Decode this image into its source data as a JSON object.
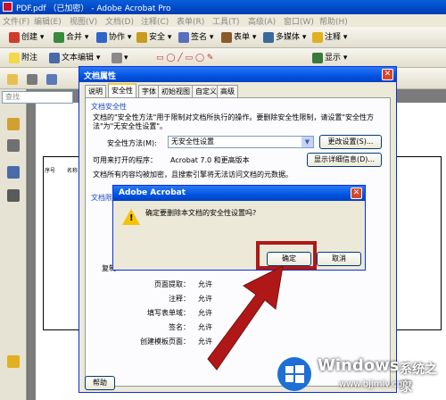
{
  "window": {
    "title": "PDF.pdf （已加密） - Adobe Acrobat Pro"
  },
  "menu": [
    "文件(F)",
    "编辑(E)",
    "视图(V)",
    "文档(D)",
    "注释(C)",
    "表单(R)",
    "工具(T)",
    "高级(A)",
    "窗口(W)",
    "帮助(H)"
  ],
  "toolbar1": {
    "create": "创建",
    "combine": "合并",
    "collaborate": "协作",
    "security": "安全",
    "sign": "签名",
    "forms": "表单",
    "multimedia": "多媒体",
    "comment": "注释"
  },
  "toolbar2": {
    "sticky_note": "附注",
    "text_edit": "文本编辑",
    "show": "显示"
  },
  "search": {
    "placeholder": "查找"
  },
  "page_table": {
    "col1": "序号",
    "col2": "名称"
  },
  "props_dialog": {
    "title": "文档属性",
    "tabs": [
      "说明",
      "安全性",
      "字体",
      "初始视图",
      "自定义",
      "高级"
    ],
    "active_tab": "安全性",
    "group1_title": "文档安全性",
    "desc": "文档的\"安全性方法\"用于限制对文档所执行的操作。要删除安全性限制，请设置\"安全性方法\"为\"无安全性设置\"。",
    "method_label": "安全性方法(M):",
    "method_value": "无安全性设置",
    "change_settings": "更改设置(S)...",
    "can_open_label": "可用来打开的程序：",
    "can_open_value": "Acrobat 7.0 和更高版本",
    "show_details": "显示详细信息(D)...",
    "metadata_note": "文档所有内容均被加密，且搜索引擎将无法访问文档的元数据。",
    "group2_title": "文档限制摘要",
    "copy_label": "复制",
    "rows": [
      {
        "label": "页面提取：",
        "value": "允许"
      },
      {
        "label": "注释：",
        "value": "允许"
      },
      {
        "label": "填写表单域：",
        "value": "允许"
      },
      {
        "label": "签名：",
        "value": "允许"
      },
      {
        "label": "创建模板页面：",
        "value": "允许"
      }
    ],
    "help_button": "帮助"
  },
  "alert_dialog": {
    "title": "Adobe Acrobat",
    "message": "确定要删除本文档的安全性设置吗?",
    "ok": "确定",
    "cancel": "取消"
  },
  "watermark": {
    "brand": "Windows",
    "name": "系统之家",
    "url": "www.bjjmlv.com"
  },
  "colors": {
    "highlight": "#b01818",
    "arrow": "#b01818",
    "title_blue": "#0054e3"
  }
}
